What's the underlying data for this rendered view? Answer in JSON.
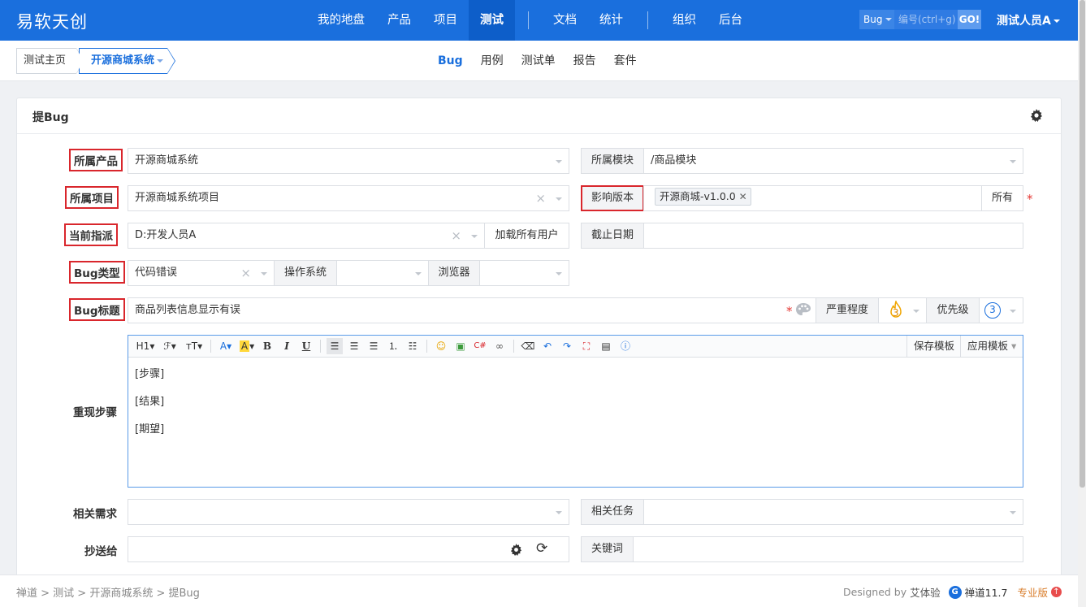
{
  "brand": "易软天创",
  "main_nav": [
    {
      "label": "我的地盘"
    },
    {
      "label": "产品"
    },
    {
      "label": "项目"
    },
    {
      "label": "测试"
    },
    {
      "label": "文档"
    },
    {
      "label": "统计"
    },
    {
      "label": "组织"
    },
    {
      "label": "后台"
    }
  ],
  "search": {
    "type": "Bug",
    "placeholder": "编号(ctrl+g)",
    "go": "GO!"
  },
  "user": "测试人员A",
  "breadcrumb": {
    "home": "测试主页",
    "product": "开源商城系统"
  },
  "sub_nav": [
    {
      "label": "Bug"
    },
    {
      "label": "用例"
    },
    {
      "label": "测试单"
    },
    {
      "label": "报告"
    },
    {
      "label": "套件"
    }
  ],
  "panel": {
    "title": "提Bug"
  },
  "form": {
    "product_label": "所属产品",
    "product_value": "开源商城系统",
    "module_label": "所属模块",
    "module_value": "/商品模块",
    "project_label": "所属项目",
    "project_value": "开源商城系统项目",
    "build_label": "影响版本",
    "build_tag": "开源商城-v1.0.0",
    "build_all": "所有",
    "assign_label": "当前指派",
    "assign_value": "D:开发人员A",
    "load_users": "加载所有用户",
    "deadline_label": "截止日期",
    "deadline_value": "",
    "type_label": "Bug类型",
    "type_value": "代码错误",
    "os_label": "操作系统",
    "os_value": "",
    "browser_label": "浏览器",
    "browser_value": "",
    "title_label": "Bug标题",
    "title_value": "商品列表信息显示有误",
    "severity_label": "严重程度",
    "severity_value": "3",
    "priority_label": "优先级",
    "priority_value": "3",
    "steps_label": "重现步骤",
    "steps_lines": [
      "[步骤]",
      "[结果]",
      "[期望]"
    ],
    "save_template": "保存模板",
    "apply_template": "应用模板",
    "story_label": "相关需求",
    "task_label": "相关任务",
    "mailto_label": "抄送给",
    "keywords_label": "关键词"
  },
  "toolbar": {
    "h1": "H1",
    "font": "ℱ",
    "size": "тT",
    "color": "A",
    "bg": "A",
    "bold": "B",
    "italic": "I",
    "underline": "U"
  },
  "footer": {
    "crumbs": "禅道 > 测试 > 开源商城系统 > 提Bug",
    "designed": "Designed by",
    "designer": "艾体验",
    "version": "禅道11.7",
    "edition": "专业版"
  },
  "colors": {
    "header": "#1a6fdd",
    "accent": "#1a6fdd",
    "required": "#e53935",
    "highlight_box": "#d9262c"
  }
}
